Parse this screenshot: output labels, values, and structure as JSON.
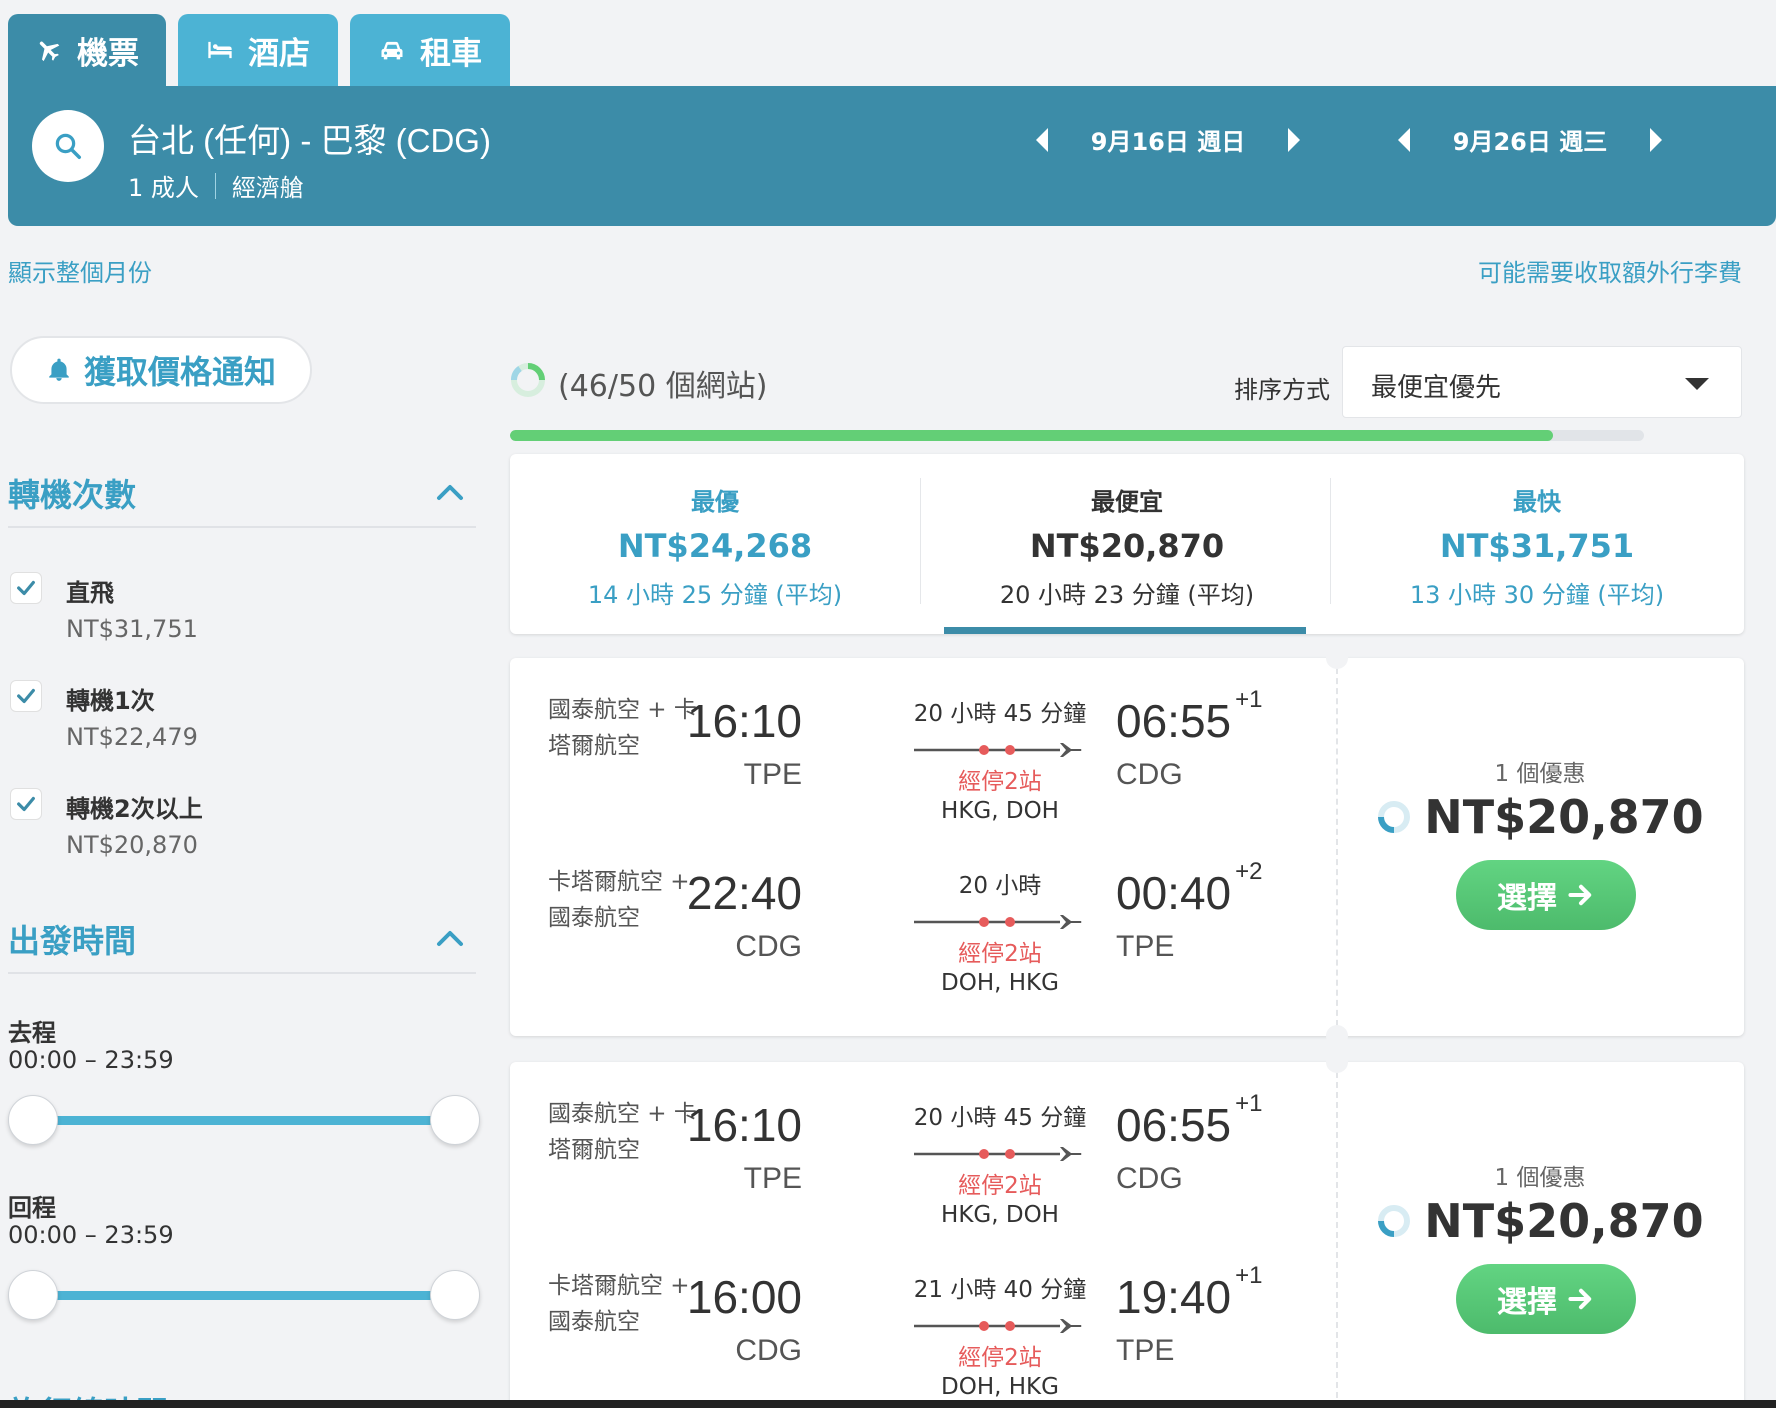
{
  "tabs": [
    {
      "label": "機票",
      "icon": "plane-icon",
      "active": true
    },
    {
      "label": "酒店",
      "icon": "bed-icon",
      "active": false
    },
    {
      "label": "租車",
      "icon": "car-icon",
      "active": false
    }
  ],
  "search": {
    "route": "台北 (任何) - 巴黎 (CDG)",
    "passengers": "1 成人",
    "cabin": "經濟艙",
    "depart_date": "9月16日 週日",
    "return_date": "9月26日 週三"
  },
  "links": {
    "show_month": "顯示整個月份",
    "baggage_fee": "可能需要收取額外行李費"
  },
  "sidebar": {
    "price_alert": "獲取價格通知",
    "stops": {
      "title": "轉機次數",
      "options": [
        {
          "label": "直飛",
          "price": "NT$31,751",
          "checked": true
        },
        {
          "label": "轉機1次",
          "price": "NT$22,479",
          "checked": true
        },
        {
          "label": "轉機2次以上",
          "price": "NT$20,870",
          "checked": true
        }
      ]
    },
    "departure_time": {
      "title": "出發時間",
      "outbound_label": "去程",
      "outbound_range": "00:00 – 23:59",
      "return_label": "回程",
      "return_range": "00:00 – 23:59"
    },
    "cut_off_title": "旅行總時間"
  },
  "results": {
    "sites_status": "(46/50 個網站)",
    "progress": 0.92,
    "sort_label": "排序方式",
    "sort_value": "最便宜優先",
    "sort_tabs": [
      {
        "title": "最優",
        "price": "NT$24,268",
        "duration": "14 小時 25 分鐘 (平均)",
        "selected": false
      },
      {
        "title": "最便宜",
        "price": "NT$20,870",
        "duration": "20 小時 23 分鐘 (平均)",
        "selected": true
      },
      {
        "title": "最快",
        "price": "NT$31,751",
        "duration": "13 小時 30 分鐘 (平均)",
        "selected": false
      }
    ],
    "cards": [
      {
        "legs": [
          {
            "airline": "國泰航空 + 卡塔爾航空",
            "dep_time": "16:10",
            "dep_code": "TPE",
            "duration": "20 小時 45 分鐘",
            "stops": "經停2站",
            "via": "HKG, DOH",
            "arr_time": "06:55",
            "arr_offset": "+1",
            "arr_code": "CDG"
          },
          {
            "airline": "卡塔爾航空 + 國泰航空",
            "dep_time": "22:40",
            "dep_code": "CDG",
            "duration": "20 小時",
            "stops": "經停2站",
            "via": "DOH, HKG",
            "arr_time": "00:40",
            "arr_offset": "+2",
            "arr_code": "TPE"
          }
        ],
        "deals": "1 個優惠",
        "price": "NT$20,870",
        "select_label": "選擇"
      },
      {
        "legs": [
          {
            "airline": "國泰航空 + 卡塔爾航空",
            "dep_time": "16:10",
            "dep_code": "TPE",
            "duration": "20 小時 45 分鐘",
            "stops": "經停2站",
            "via": "HKG, DOH",
            "arr_time": "06:55",
            "arr_offset": "+1",
            "arr_code": "CDG"
          },
          {
            "airline": "卡塔爾航空 + 國泰航空",
            "dep_time": "16:00",
            "dep_code": "CDG",
            "duration": "21 小時 40 分鐘",
            "stops": "經停2站",
            "via": "DOH, HKG",
            "arr_time": "19:40",
            "arr_offset": "+1",
            "arr_code": "TPE"
          }
        ],
        "deals": "1 個優惠",
        "price": "NT$20,870",
        "select_label": "選擇"
      }
    ]
  },
  "colors": {
    "brand": "#3c8ca8",
    "tab": "#4cb3d4",
    "link": "#3a9fc4",
    "stops_red": "#e65b5b",
    "select_green": "#59c97a",
    "progress_green": "#63cf76"
  }
}
